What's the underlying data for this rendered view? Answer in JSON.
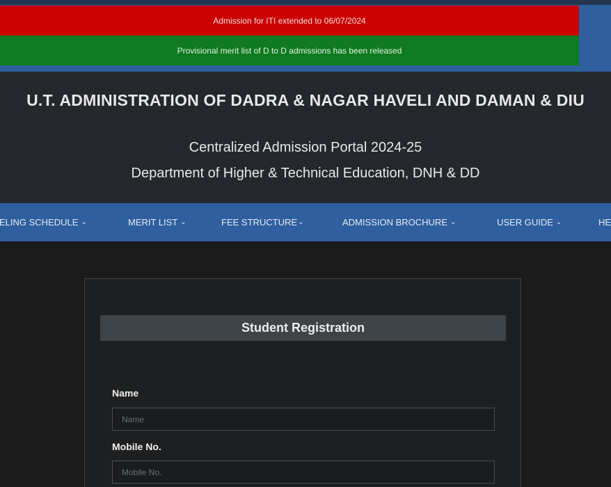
{
  "notices": {
    "red": "Admission for ITI extended to 06/07/2024",
    "green": "Provisional merit list of D to D admissions has been released"
  },
  "header": {
    "title": "U.T. ADMINISTRATION OF DADRA & NAGAR HAVELI AND DAMAN & DIU",
    "subtitle": "Centralized Admission Portal 2024-25",
    "department": "Department of Higher & Technical Education, DNH & DD"
  },
  "nav": {
    "items": [
      {
        "label": "ELING SCHEDULE"
      },
      {
        "label": "MERIT LIST"
      },
      {
        "label": "FEE STRUCTURE"
      },
      {
        "label": "ADMISSION BROCHURE"
      },
      {
        "label": "USER GUIDE"
      },
      {
        "label": "HE"
      }
    ],
    "chevron": "⌄"
  },
  "form": {
    "title": "Student Registration",
    "name_label": "Name",
    "name_placeholder": "Name",
    "mobile_label": "Mobile No.",
    "mobile_placeholder": "Mobile No."
  },
  "colors": {
    "notice_red": "#cc0000",
    "notice_green": "#0f7a1f",
    "nav_blue": "#2f5f9e",
    "header_bg": "#24272b",
    "page_bg": "#1b1b1b"
  }
}
